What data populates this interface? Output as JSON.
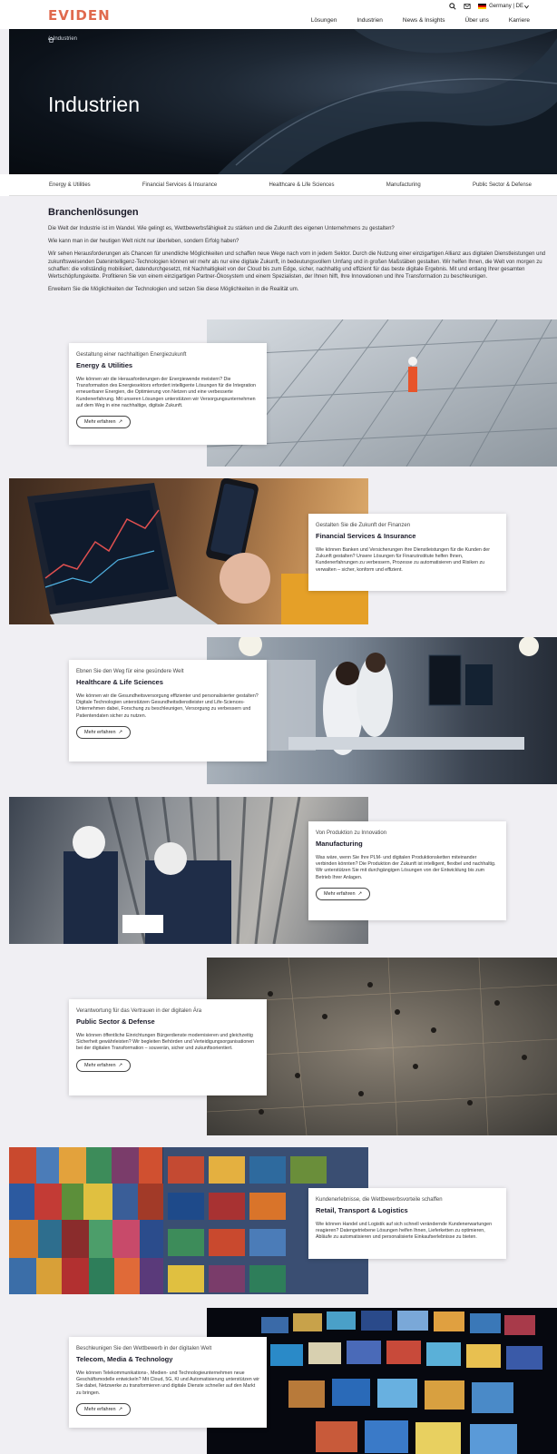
{
  "header": {
    "logo": "EVIDEN",
    "country": "Germany | DE",
    "icons": [
      "search-icon",
      "mail-icon",
      "chevron-down-icon"
    ],
    "nav": [
      "Lösungen",
      "Industrien",
      "News & Insights",
      "Über uns",
      "Karriere"
    ]
  },
  "hero": {
    "breadcrumb": "Industrien",
    "title": "Industrien"
  },
  "tabs": [
    "Energy & Utilities",
    "Financial Services & Insurance",
    "Healthcare & Life Sciences",
    "Manufacturing",
    "Public Sector & Defense"
  ],
  "intro": {
    "title": "Branchenlösungen",
    "p1": "Die Welt der Industrie ist im Wandel. Wie gelingt es, Wettbewerbsfähigkeit zu stärken und die Zukunft des eigenen Unternehmens zu gestalten?",
    "p2": "Wie kann man in der heutigen Welt nicht nur überleben, sondern Erfolg haben?",
    "p3": "Wir sehen Herausforderungen als Chancen für unendliche Möglichkeiten und schaffen neue Wege nach vorn in jedem Sektor. Durch die Nutzung einer einzigartigen Allianz aus digitalen Dienstleistungen und zukunftsweisenden Datenintelligenz-Technologien können wir mehr als nur eine digitale Zukunft, in bedeutungsvollem Umfang und in großen Maßstäben gestalten. Wir helfen Ihnen, die Welt von morgen zu schaffen: die vollständig mobilisiert, datendurchgesetzt, mit Nachhaltigkeit von der Cloud bis zum Edge, sicher, nachhaltig und effizient für das beste digitale Ergebnis. Mit und entlang Ihrer gesamten Wertschöpfungskette. Profitieren Sie von einem einzigartigen Partner-Ökosystem und einem Spezialisten, der Ihnen hilft, Ihre Innovationen und Ihre Transformation zu beschleunigen.",
    "p4": "Erweitern Sie die Möglichkeiten der Technologien und setzen Sie diese Möglichkeiten in die Realität um."
  },
  "cards": [
    {
      "eyebrow": "Gestaltung einer nachhaltigen Energiezukunft",
      "title": "Energy & Utilities",
      "text": "Wie können wir die Herausforderungen der Energiewende meistern? Die Transformation des Energiesektors erfordert intelligente Lösungen für die Integration erneuerbarer Energien, die Optimierung von Netzen und eine verbesserte Kundenerfahrung. Mit unseren Lösungen unterstützen wir Versorgungsunternehmen auf dem Weg in eine nachhaltige, digitale Zukunft.",
      "button": "Mehr erfahren"
    },
    {
      "eyebrow": "Gestalten Sie die Zukunft der Finanzen",
      "title": "Financial Services & Insurance",
      "text": "Wie können Banken und Versicherungen ihre Dienstleistungen für die Kunden der Zukunft gestalten? Unsere Lösungen für Finanzinstitute helfen Ihnen, Kundenerfahrungen zu verbessern, Prozesse zu automatisieren und Risiken zu verwalten – sicher, konform und effizient.",
      "button": "Mehr erfahren"
    },
    {
      "eyebrow": "Ebnen Sie den Weg für eine gesündere Welt",
      "title": "Healthcare & Life Sciences",
      "text": "Wie können wir die Gesundheitsversorgung effizienter und personalisierter gestalten? Digitale Technologien unterstützen Gesundheitsdienstleister und Life-Sciences-Unternehmen dabei, Forschung zu beschleunigen, Versorgung zu verbessern und Patientendaten sicher zu nutzen.",
      "button": "Mehr erfahren"
    },
    {
      "eyebrow": "Von Produktion zu Innovation",
      "title": "Manufacturing",
      "text": "Was wäre, wenn Sie Ihre PLM- und digitalen Produktionsketten miteinander verbinden könnten? Die Produktion der Zukunft ist intelligent, flexibel und nachhaltig. Wir unterstützen Sie mit durchgängigen Lösungen von der Entwicklung bis zum Betrieb Ihrer Anlagen.",
      "button": "Mehr erfahren"
    },
    {
      "eyebrow": "Verantwortung für das Vertrauen in der digitalen Ära",
      "title": "Public Sector & Defense",
      "text": "Wie können öffentliche Einrichtungen Bürgerdienste modernisieren und gleichzeitig Sicherheit gewährleisten? Wir begleiten Behörden und Verteidigungsorganisationen bei der digitalen Transformation – souverän, sicher und zukunftsorientiert.",
      "button": "Mehr erfahren"
    },
    {
      "eyebrow": "Kundenerlebnisse, die Wettbewerbsvorteile schaffen",
      "title": "Retail, Transport & Logistics",
      "text": "Wie können Handel und Logistik auf sich schnell verändernde Kundenerwartungen reagieren? Datengetriebene Lösungen helfen Ihnen, Lieferketten zu optimieren, Abläufe zu automatisieren und personalisierte Einkaufserlebnisse zu bieten.",
      "button": "Mehr erfahren"
    },
    {
      "eyebrow": "Beschleunigen Sie den Wettbewerb in der digitalen Welt",
      "title": "Telecom, Media & Technology",
      "text": "Wie können Telekommunikations-, Medien- und Technologieunternehmen neue Geschäftsmodelle entwickeln? Mit Cloud, 5G, KI und Automatisierung unterstützen wir Sie dabei, Netzwerke zu transformieren und digitale Dienste schneller auf den Markt zu bringen.",
      "button": "Mehr erfahren"
    }
  ],
  "colors": {
    "brand": "#e06a4e",
    "hero_bg": "#0c121a",
    "page_bg": "#f0eff3"
  }
}
